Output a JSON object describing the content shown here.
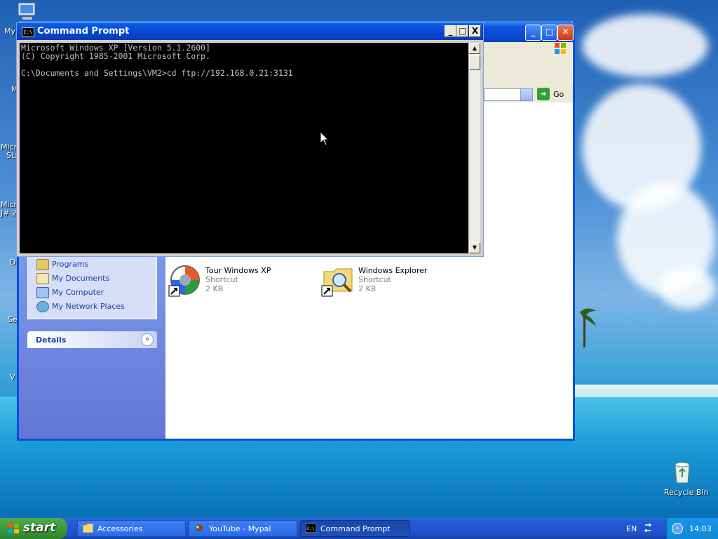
{
  "desktop": {
    "icons": [
      {
        "name": "desktop-icon-my-computer",
        "label": "My"
      },
      {
        "name": "desktop-icon-2",
        "label": "M"
      },
      {
        "name": "desktop-icon-3",
        "label": "Micr"
      },
      {
        "name": "desktop-icon-3b",
        "label": "Stu"
      },
      {
        "name": "desktop-icon-4",
        "label": "Micr"
      },
      {
        "name": "desktop-icon-4b",
        "label": "J# 2"
      },
      {
        "name": "desktop-icon-5",
        "label": "D"
      },
      {
        "name": "desktop-icon-6",
        "label": "Se"
      },
      {
        "name": "desktop-icon-7",
        "label": "V"
      }
    ],
    "recycle_bin": "Recycle Bin"
  },
  "explorer": {
    "address_go": "Go",
    "tasks": [
      {
        "label": "Programs"
      },
      {
        "label": "My Documents"
      },
      {
        "label": "My Computer"
      },
      {
        "label": "My Network Places"
      }
    ],
    "details_label": "Details",
    "files": [
      {
        "name": "Tour Windows XP",
        "type": "Shortcut",
        "size": "2 KB"
      },
      {
        "name": "Windows Explorer",
        "type": "Shortcut",
        "size": "2 KB"
      }
    ]
  },
  "cmd": {
    "title": "Command Prompt",
    "icon_text": "C:\\",
    "lines": [
      "Microsoft Windows XP [Version 5.1.2600]",
      "(C) Copyright 1985-2001 Microsoft Corp.",
      "",
      "C:\\Documents and Settings\\VM2>cd ftp://192.168.0.21:3131"
    ],
    "btn_min": "_",
    "btn_max": "□",
    "btn_close": "X"
  },
  "taskbar": {
    "start_label": "start",
    "tasks": [
      {
        "label": "Accessories"
      },
      {
        "label": "YouTube - Mypal"
      },
      {
        "label": "Command Prompt"
      }
    ],
    "language": "EN",
    "clock": "14:03"
  },
  "colors": {
    "titlebar_blue": "#0a4bd0",
    "start_green": "#3a993a",
    "console_text": "#c0c0c0"
  }
}
